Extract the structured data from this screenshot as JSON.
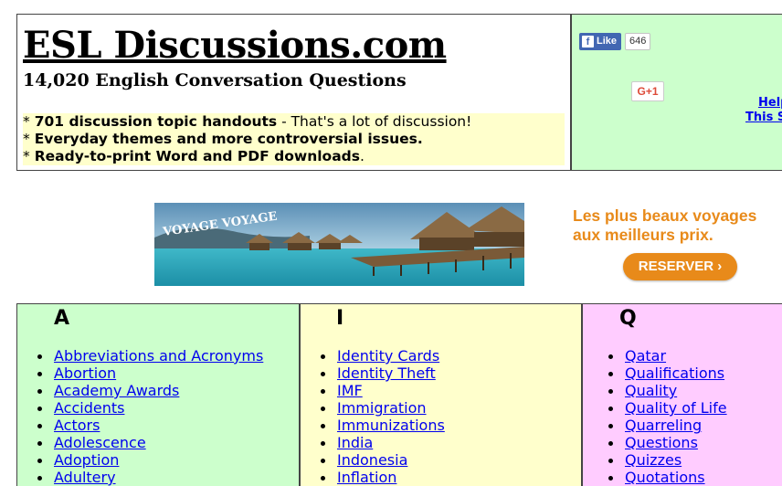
{
  "header": {
    "title": "ESL Discussions.com",
    "subtitle": "14,020 English Conversation Questions",
    "promo": [
      {
        "bullet": "*",
        "bold": "701 discussion topic handouts",
        "rest": " - That's a lot of discussion!"
      },
      {
        "bullet": "*",
        "bold": "Everyday themes and more controversial issues.",
        "rest": ""
      },
      {
        "bullet": "*",
        "bold": "Ready-to-print Word and PDF downloads",
        "rest": "."
      }
    ]
  },
  "social": {
    "like_label": "Like",
    "like_count": "646",
    "gplus_label": "G+1"
  },
  "help_links": [
    "Help",
    "This S"
  ],
  "ad": {
    "banner_text": "VOYAGE VOYAGE",
    "line1": "Les plus beaux voyages",
    "line2": "aux meilleurs prix.",
    "button_label": "RESERVER ›",
    "accent_color": "#e88a1a"
  },
  "topics": {
    "columns": [
      {
        "letter": "A",
        "color": "#ccffcc",
        "items": [
          "Abbreviations and Acronyms",
          "Abortion",
          "Academy Awards",
          "Accidents",
          "Actors",
          "Adolescence",
          "Adoption",
          "Adultery"
        ]
      },
      {
        "letter": "I",
        "color": "#ffffcc",
        "items": [
          "Identity Cards",
          "Identity Theft",
          "IMF",
          "Immigration",
          "Immunizations",
          "India",
          "Indonesia",
          "Inflation"
        ]
      },
      {
        "letter": "Q",
        "color": "#ffccff",
        "items": [
          "Qatar",
          "Qualifications",
          "Quality",
          "Quality of Life",
          "Quarreling",
          "Questions",
          "Quizzes",
          "Quotations"
        ]
      }
    ]
  }
}
